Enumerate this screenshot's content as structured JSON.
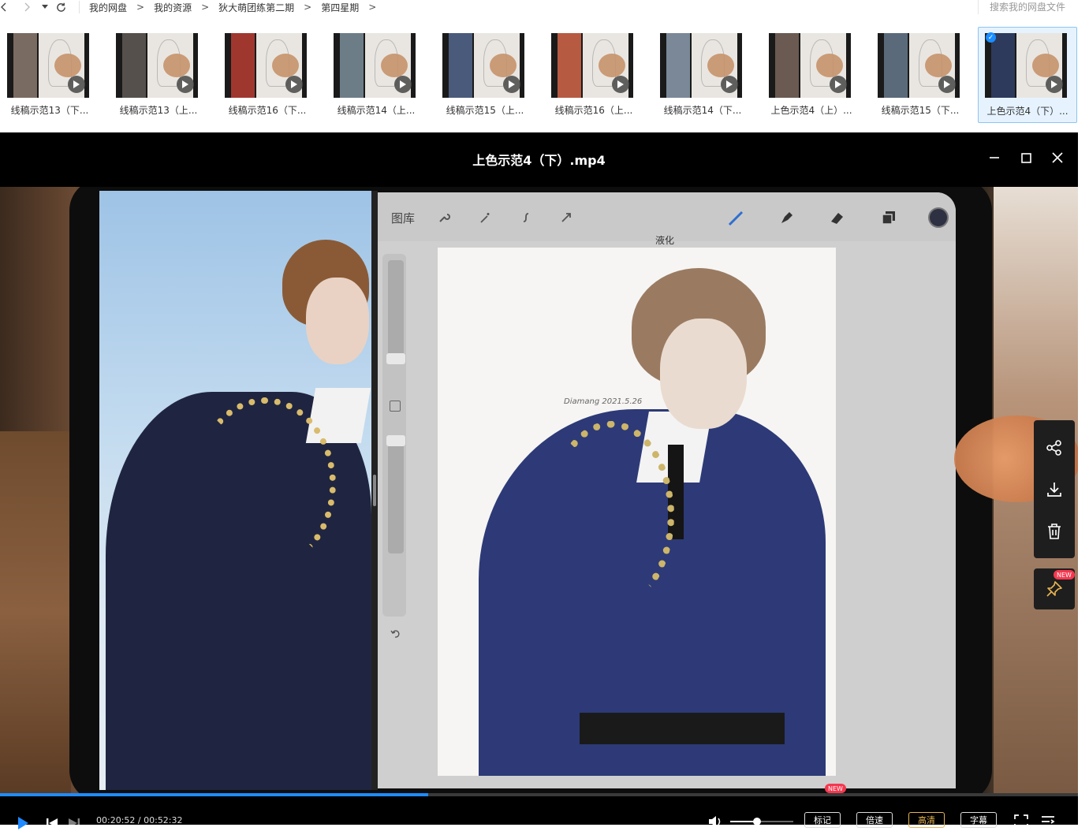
{
  "nav": {
    "back_icon": "chevron-left-icon",
    "forward_icon": "chevron-right-icon",
    "dropdown_icon": "caret-down-icon",
    "refresh_icon": "refresh-icon",
    "breadcrumbs": [
      "我的网盘",
      "我的资源",
      "狄大萌团练第二期",
      "第四星期"
    ],
    "separator": ">",
    "search_placeholder": "搜索我的网盘文件"
  },
  "thumbnails": [
    {
      "label": "线稿示范13（下...",
      "selected": false
    },
    {
      "label": "线稿示范13（上...",
      "selected": false
    },
    {
      "label": "线稿示范16（下...",
      "selected": false
    },
    {
      "label": "线稿示范14（上...",
      "selected": false
    },
    {
      "label": "线稿示范15（上...",
      "selected": false
    },
    {
      "label": "线稿示范16（上...",
      "selected": false
    },
    {
      "label": "线稿示范14（下...",
      "selected": false
    },
    {
      "label": "上色示范4（上）...",
      "selected": false
    },
    {
      "label": "线稿示范15（下...",
      "selected": false
    },
    {
      "label": "上色示范4（下）...",
      "selected": true
    }
  ],
  "player": {
    "title": "上色示范4（下）.mp4",
    "window_controls": [
      "minimize-icon",
      "maximize-icon",
      "close-icon"
    ],
    "video": {
      "app_gallery_label": "图库",
      "app_liquify_label": "液化",
      "signature": "Diamang 2021.5.26"
    },
    "side_actions": [
      "share-icon",
      "download-icon",
      "delete-icon"
    ],
    "pin_badge": "NEW",
    "progress_fraction": 0.397,
    "time_current": "00:20:52",
    "time_total": "00:52:32",
    "time_separator": " / ",
    "volume_fraction": 0.42,
    "buttons": {
      "mark": "标记",
      "mark_badge": "NEW",
      "speed": "倍速",
      "quality": "高清",
      "subtitle": "字幕"
    },
    "accent_color": "#1f8bff",
    "quality_color": "#e8b450",
    "badge_color": "#f5384f"
  }
}
